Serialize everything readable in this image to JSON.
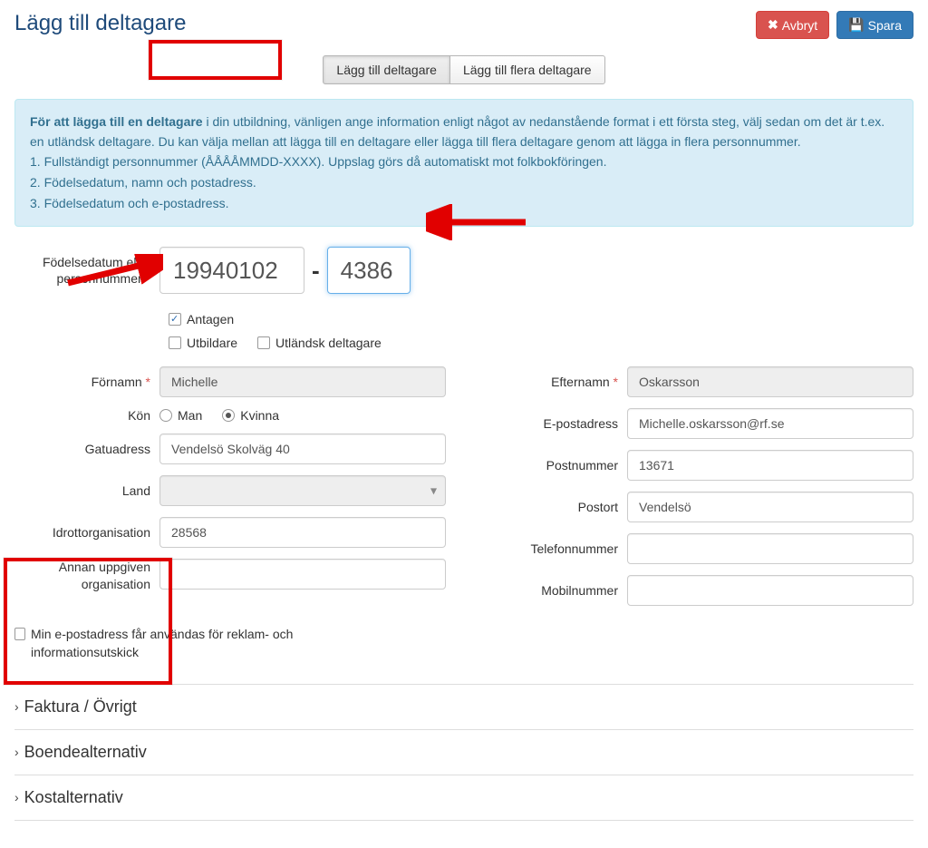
{
  "header": {
    "title": "Lägg till deltagare",
    "cancel": "Avbryt",
    "save": "Spara"
  },
  "tabs": {
    "single": "Lägg till deltagare",
    "multi": "Lägg till flera deltagare"
  },
  "info": {
    "bold": "För att lägga till en deltagare",
    "rest1": " i din utbildning, vänligen ange information enligt något av nedanstående format i ett första steg, välj sedan om det är t.ex. en utländsk deltagare. Du kan välja mellan att lägga till en deltagare eller lägga till flera deltagare genom att lägga in flera personnummer.",
    "l1": "1. Fullständigt personnummer (ÅÅÅÅMMDD-XXXX). Uppslag görs då automatiskt mot folkbokföringen.",
    "l2": "2. Födelsedatum, namn och postadress.",
    "l3": "3. Födelsedatum och e-postadress."
  },
  "pnr": {
    "label": "Födelsedatum eller personnummer",
    "date": "19940102",
    "suffix": "4386"
  },
  "checks": {
    "antagen": "Antagen",
    "utbildare": "Utbildare",
    "utlandsk": "Utländsk deltagare",
    "marketing": "Min e-postadress får användas för reklam- och informationsutskick"
  },
  "left": {
    "fornamn_label": "Förnamn",
    "fornamn": "Michelle",
    "kon_label": "Kön",
    "kon_man": "Man",
    "kon_kvinna": "Kvinna",
    "gatu_label": "Gatuadress",
    "gatu": "Vendelsö Skolväg 40",
    "land_label": "Land",
    "land": "",
    "idrott_label": "Idrottorganisation",
    "idrott": "28568",
    "annan_label1": "Annan uppgiven",
    "annan_label2": "organisation"
  },
  "right": {
    "efternamn_label": "Efternamn",
    "efternamn": "Oskarsson",
    "epost_label": "E-postadress",
    "epost": "Michelle.oskarsson@rf.se",
    "postnr_label": "Postnummer",
    "postnr": "13671",
    "postort_label": "Postort",
    "postort": "Vendelsö",
    "tel_label": "Telefonnummer",
    "mob_label": "Mobilnummer"
  },
  "accordion": {
    "faktura": "Faktura / Övrigt",
    "boende": "Boendealternativ",
    "kost": "Kostalternativ"
  }
}
